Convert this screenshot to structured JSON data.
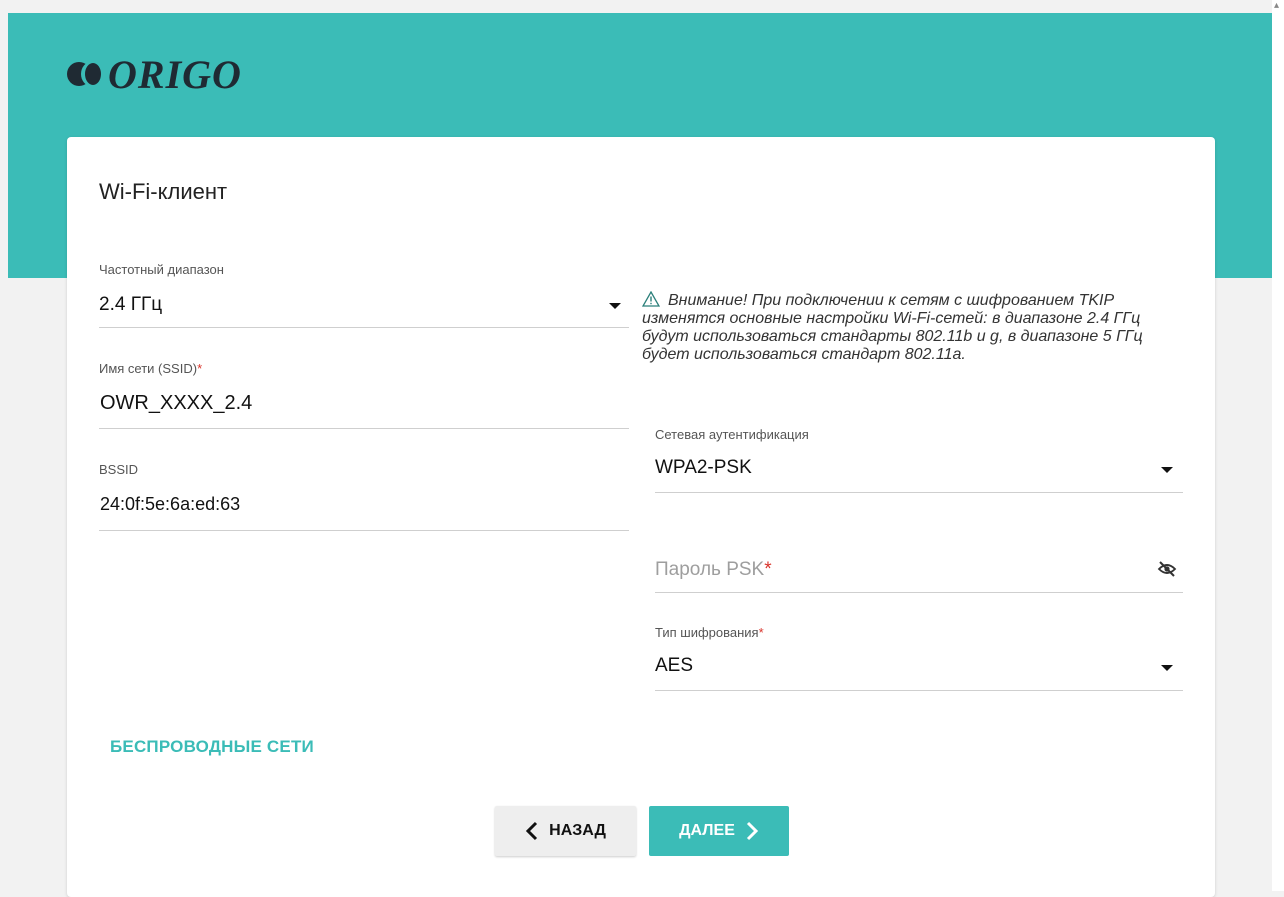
{
  "brand": {
    "name": "ORIGO",
    "accent": "#3bbcb7"
  },
  "page": {
    "title": "Wi-Fi-клиент"
  },
  "fields": {
    "band": {
      "label": "Частотный диапазон",
      "value": "2.4 ГГц"
    },
    "ssid": {
      "label": "Имя сети (SSID)",
      "required": "*",
      "value": "OWR_XXXX_2.4"
    },
    "bssid": {
      "label": "BSSID",
      "value": "24:0f:5e:6a:ed:63"
    },
    "auth": {
      "label": "Сетевая аутентификация",
      "value": "WPA2-PSK"
    },
    "psk": {
      "placeholder": "Пароль PSK",
      "required": "*"
    },
    "cipher": {
      "label": "Тип шифрования",
      "required": "*",
      "value": "AES"
    }
  },
  "warning": {
    "text": "Внимание! При подключении к сетям с шифрованием TKIP изменятся основные настройки Wi-Fi-сетей: в диапазоне 2.4 ГГц будут использоваться стандарты 802.11b и g, в диапазоне 5 ГГц будет использоваться стандарт 802.11a."
  },
  "links": {
    "wireless": "БЕСПРОВОДНЫЕ СЕТИ"
  },
  "buttons": {
    "back": "НАЗАД",
    "next": "ДАЛЕЕ"
  },
  "icons": {
    "logo": "origo-logo-icon",
    "dropdown": "caret-down-icon",
    "warning": "warning-triangle-icon",
    "password_toggle": "eye-off-icon",
    "back": "chevron-left-icon",
    "next": "chevron-right-icon"
  }
}
